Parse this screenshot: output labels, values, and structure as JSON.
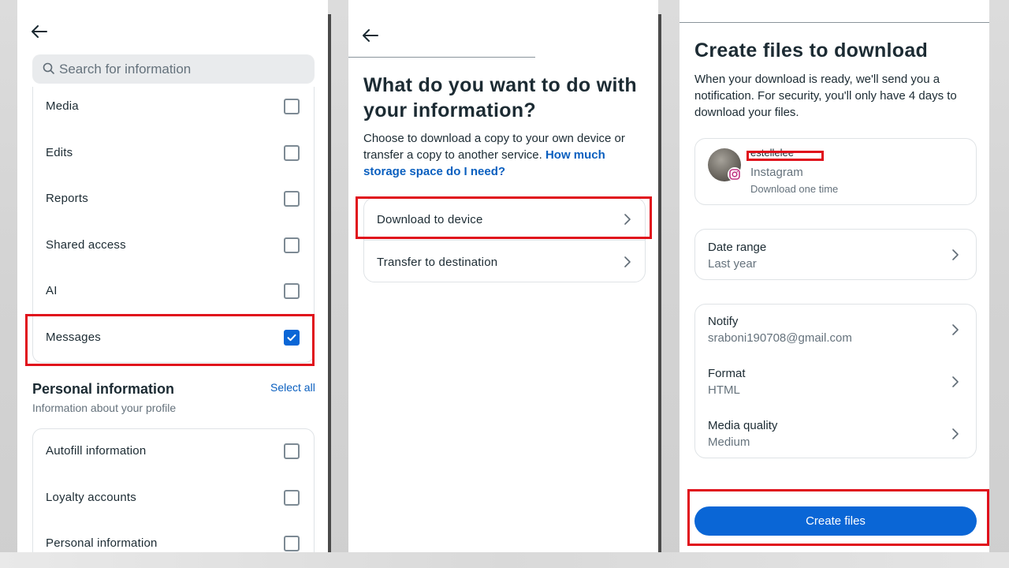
{
  "panel1": {
    "search_placeholder": "Search for information",
    "items": [
      {
        "label": "Media",
        "checked": false
      },
      {
        "label": "Edits",
        "checked": false
      },
      {
        "label": "Reports",
        "checked": false
      },
      {
        "label": "Shared access",
        "checked": false
      },
      {
        "label": "AI",
        "checked": false
      },
      {
        "label": "Messages",
        "checked": true
      }
    ],
    "section_title": "Personal information",
    "section_subtitle": "Information about your profile",
    "select_all": "Select all",
    "section_items": [
      {
        "label": "Autofill information",
        "checked": false
      },
      {
        "label": "Loyalty accounts",
        "checked": false
      },
      {
        "label": "Personal information",
        "checked": false
      }
    ]
  },
  "panel2": {
    "heading": "What do you want to do with your information?",
    "description": "Choose to download a copy to your own device or transfer a copy to another service.",
    "link": "How much storage space do I need?",
    "options": [
      {
        "label": "Download to device"
      },
      {
        "label": "Transfer to destination"
      }
    ]
  },
  "panel3": {
    "heading": "Create files to download",
    "description": "When your download is ready, we'll send you a notification. For security, you'll only have 4 days to download your files.",
    "account": {
      "username": "estellelee",
      "platform": "Instagram",
      "frequency": "Download one time"
    },
    "date_range": {
      "label": "Date range",
      "value": "Last year"
    },
    "notify": {
      "label": "Notify",
      "value": "sraboni190708@gmail.com"
    },
    "format": {
      "label": "Format",
      "value": "HTML"
    },
    "media_quality": {
      "label": "Media quality",
      "value": "Medium"
    },
    "create_button": "Create files"
  },
  "colors": {
    "accent": "#0a66d6",
    "highlight": "#e0101b",
    "link": "#0a5fbf"
  }
}
